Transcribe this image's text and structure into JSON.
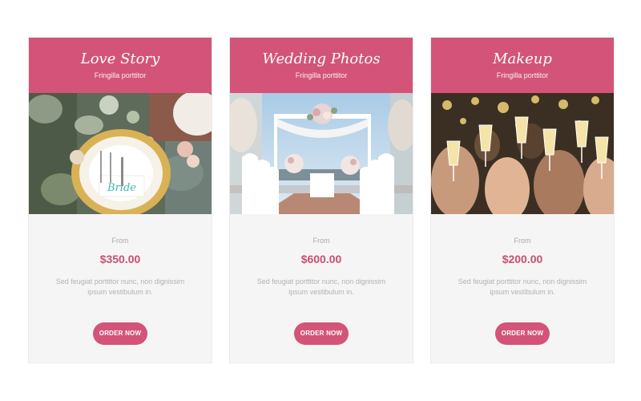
{
  "cards": [
    {
      "title": "Love Story",
      "subtitle": "Fringilla porttitor",
      "image_label": "Bride",
      "from_label": "From",
      "price": "$350.00",
      "description": "Sed feugiat porttitor nunc, non dignissim ipsum vestibulum in.",
      "button_label": "ORDER NOW"
    },
    {
      "title": "Wedding Photos",
      "subtitle": "Fringilla porttitor",
      "from_label": "From",
      "price": "$600.00",
      "description": "Sed feugiat porttitor nunc, non dignissim ipsum vestibulum in.",
      "button_label": "ORDER NOW"
    },
    {
      "title": "Makeup",
      "subtitle": "Fringilla porttitor",
      "from_label": "From",
      "price": "$200.00",
      "description": "Sed feugiat porttitor nunc, non dignissim ipsum vestibulum in.",
      "button_label": "ORDER NOW"
    }
  ],
  "colors": {
    "accent": "#d35478",
    "price": "#c9506f",
    "card_bg": "#f5f5f5"
  }
}
